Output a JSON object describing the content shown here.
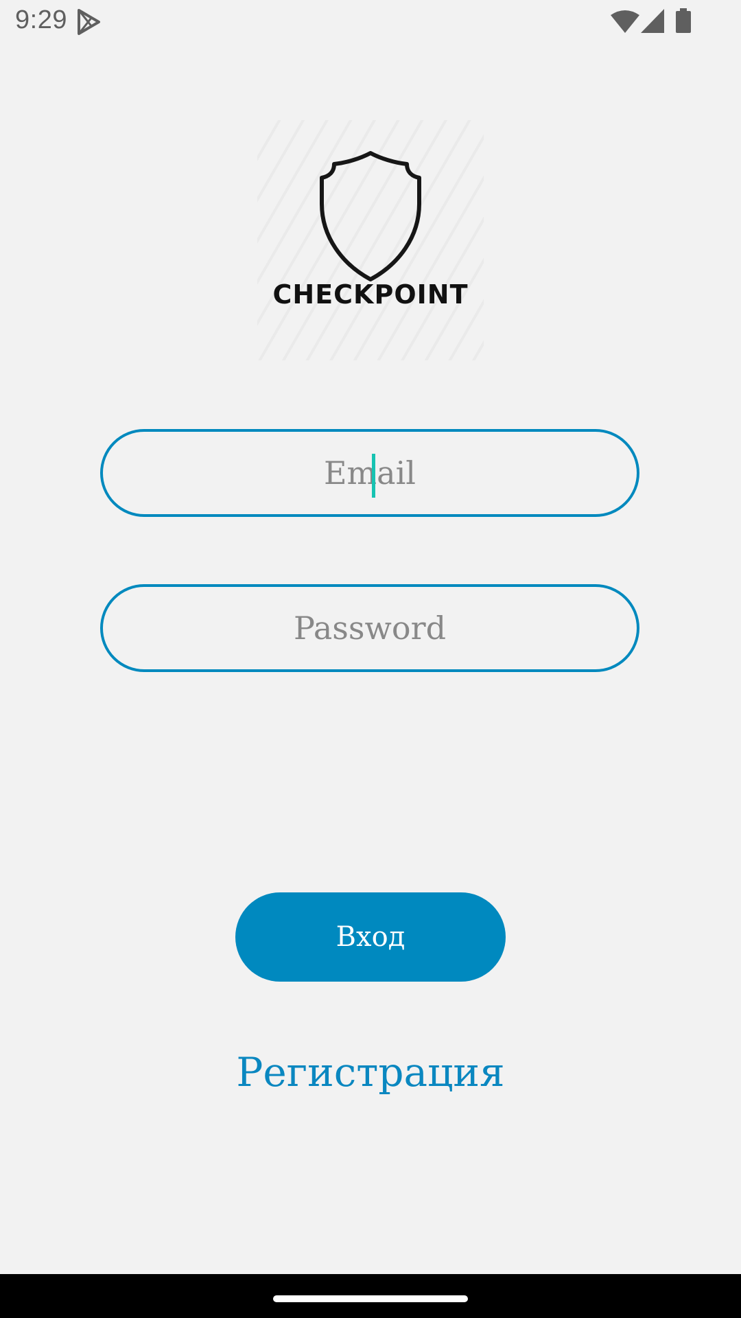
{
  "status_bar": {
    "time": "9:29",
    "icons": [
      "play-store-icon",
      "wifi-icon",
      "signal-icon",
      "battery-icon"
    ]
  },
  "logo": {
    "brand_name": "CHECKPOINT",
    "icon": "shield-icon"
  },
  "login_form": {
    "email_placeholder": "Email",
    "email_value": "",
    "password_placeholder": "Password",
    "password_value": ""
  },
  "actions": {
    "login_label": "Вход",
    "register_label": "Регистрация"
  },
  "colors": {
    "accent": "#0089be",
    "background": "#f2f2f2",
    "cursor": "#17c3b2"
  }
}
